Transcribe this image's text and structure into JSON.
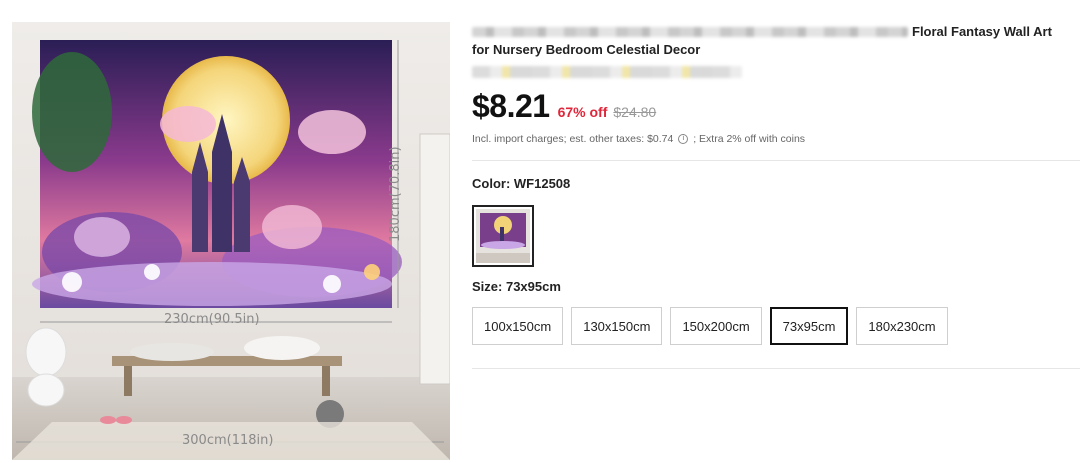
{
  "product": {
    "title_visible": "Floral Fantasy Wall Art",
    "title_line2": "for Nursery Bedroom Celestial Decor"
  },
  "image": {
    "dim_width_tapestry": "230cm(90.5in)",
    "dim_height_tapestry": "180cm(70.8in)",
    "dim_width_wall": "300cm(118in)"
  },
  "pricing": {
    "price": "$8.21",
    "discount": "67% off",
    "original_price": "$24.80",
    "tax_note_prefix": "Incl. import charges; est. other taxes: $0.74",
    "tax_note_suffix": "; Extra 2% off with coins",
    "info_icon": "info-icon"
  },
  "color": {
    "label": "Color:",
    "selected": "WF12508"
  },
  "size": {
    "label": "Size:",
    "selected": "73x95cm",
    "options": [
      "100x150cm",
      "130x150cm",
      "150x200cm",
      "73x95cm",
      "180x230cm"
    ]
  },
  "colors": {
    "discount_red": "#e0263a",
    "price_black": "#111111",
    "selected_border": "#111111"
  }
}
